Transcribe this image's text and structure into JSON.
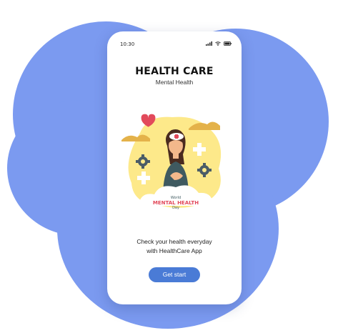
{
  "status_bar": {
    "time": "10:30"
  },
  "header": {
    "title": "HEALTH CARE",
    "subtitle": "Mental Health"
  },
  "illustration": {
    "tag_line1": "World",
    "tag_line2": "MENTAL HEALTH",
    "tag_line3": "Day"
  },
  "description": {
    "line1": "Check your health everyday",
    "line2": "with HealthCare App"
  },
  "cta": {
    "label": "Get start"
  },
  "colors": {
    "background_blob": "#7b9af0",
    "button": "#4a7bd6",
    "illustration_bg": "#fde98a",
    "heart": "#e24a5b"
  }
}
